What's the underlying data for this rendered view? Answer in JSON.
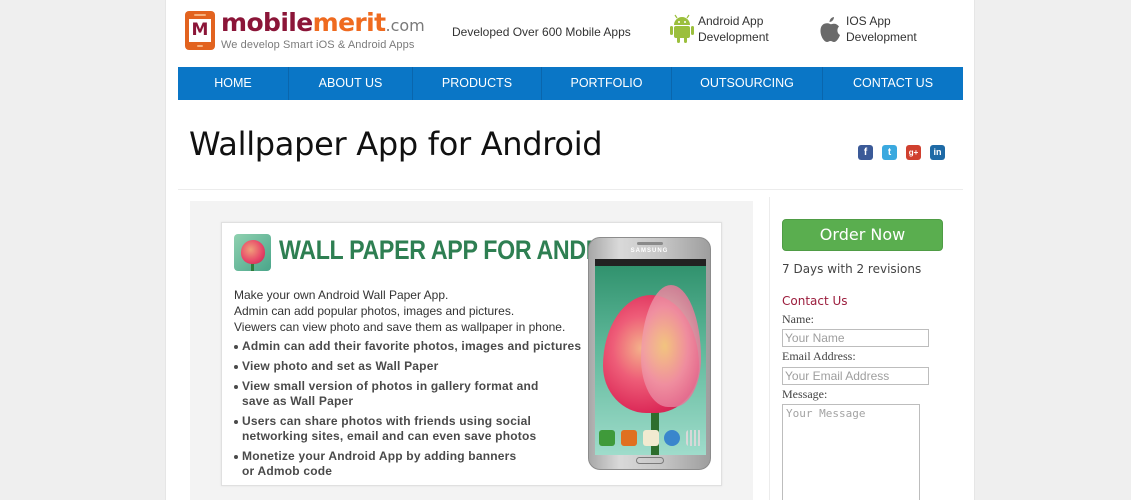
{
  "header": {
    "logo": {
      "mark_letter": "M",
      "name_part1": "mobile",
      "name_part2": "merit",
      "name_part3": ".com",
      "tagline": "We develop Smart iOS & Android Apps"
    },
    "tagline": "Developed Over 600 Mobile Apps",
    "links": [
      {
        "icon": "android-icon",
        "line1": "Android App",
        "line2": "Development"
      },
      {
        "icon": "apple-icon",
        "line1": "IOS App",
        "line2": "Development"
      }
    ]
  },
  "nav": {
    "items": [
      {
        "label": "HOME"
      },
      {
        "label": "ABOUT US"
      },
      {
        "label": "PRODUCTS"
      },
      {
        "label": "PORTFOLIO"
      },
      {
        "label": "OUTSOURCING"
      },
      {
        "label": "CONTACT US"
      }
    ],
    "color": "#0a76c6"
  },
  "page": {
    "title": "Wallpaper App for Android",
    "social": [
      {
        "name": "facebook",
        "glyph": "f"
      },
      {
        "name": "twitter",
        "glyph": "t"
      },
      {
        "name": "google-plus",
        "glyph": "g+"
      },
      {
        "name": "linkedin",
        "glyph": "in"
      }
    ]
  },
  "product": {
    "title": "WALL PAPER APP FOR ANDROID",
    "title_color": "#2e7f52",
    "intro": [
      "Make your own Android Wall Paper App.",
      "Admin can add popular photos, images and pictures.",
      "Viewers can view photo and save them as wallpaper in phone."
    ],
    "features": [
      {
        "lines": [
          "Admin can add their favorite photos, images and pictures"
        ]
      },
      {
        "lines": [
          "View photo and set as Wall Paper"
        ]
      },
      {
        "lines": [
          "View small version of photos in gallery format and",
          "save as Wall Paper"
        ]
      },
      {
        "lines": [
          "Users can share photos with friends using social",
          "networking sites, email and can even save photos"
        ]
      },
      {
        "lines": [
          "Monetize your Android App by adding banners",
          "or Admob code"
        ]
      }
    ],
    "phone_brand": "SAMSUNG"
  },
  "sidebar": {
    "order_button": "Order Now",
    "order_color": "#5aae4f",
    "delivery": "7 Days with 2 revisions",
    "contact_title": "Contact Us",
    "form": {
      "name_label": "Name:",
      "name_placeholder": "Your Name",
      "name_value": "",
      "email_label": "Email Address:",
      "email_placeholder": "Your Email Address",
      "email_value": "",
      "message_label": "Message:",
      "message_placeholder": "Your Message",
      "message_value": ""
    }
  }
}
